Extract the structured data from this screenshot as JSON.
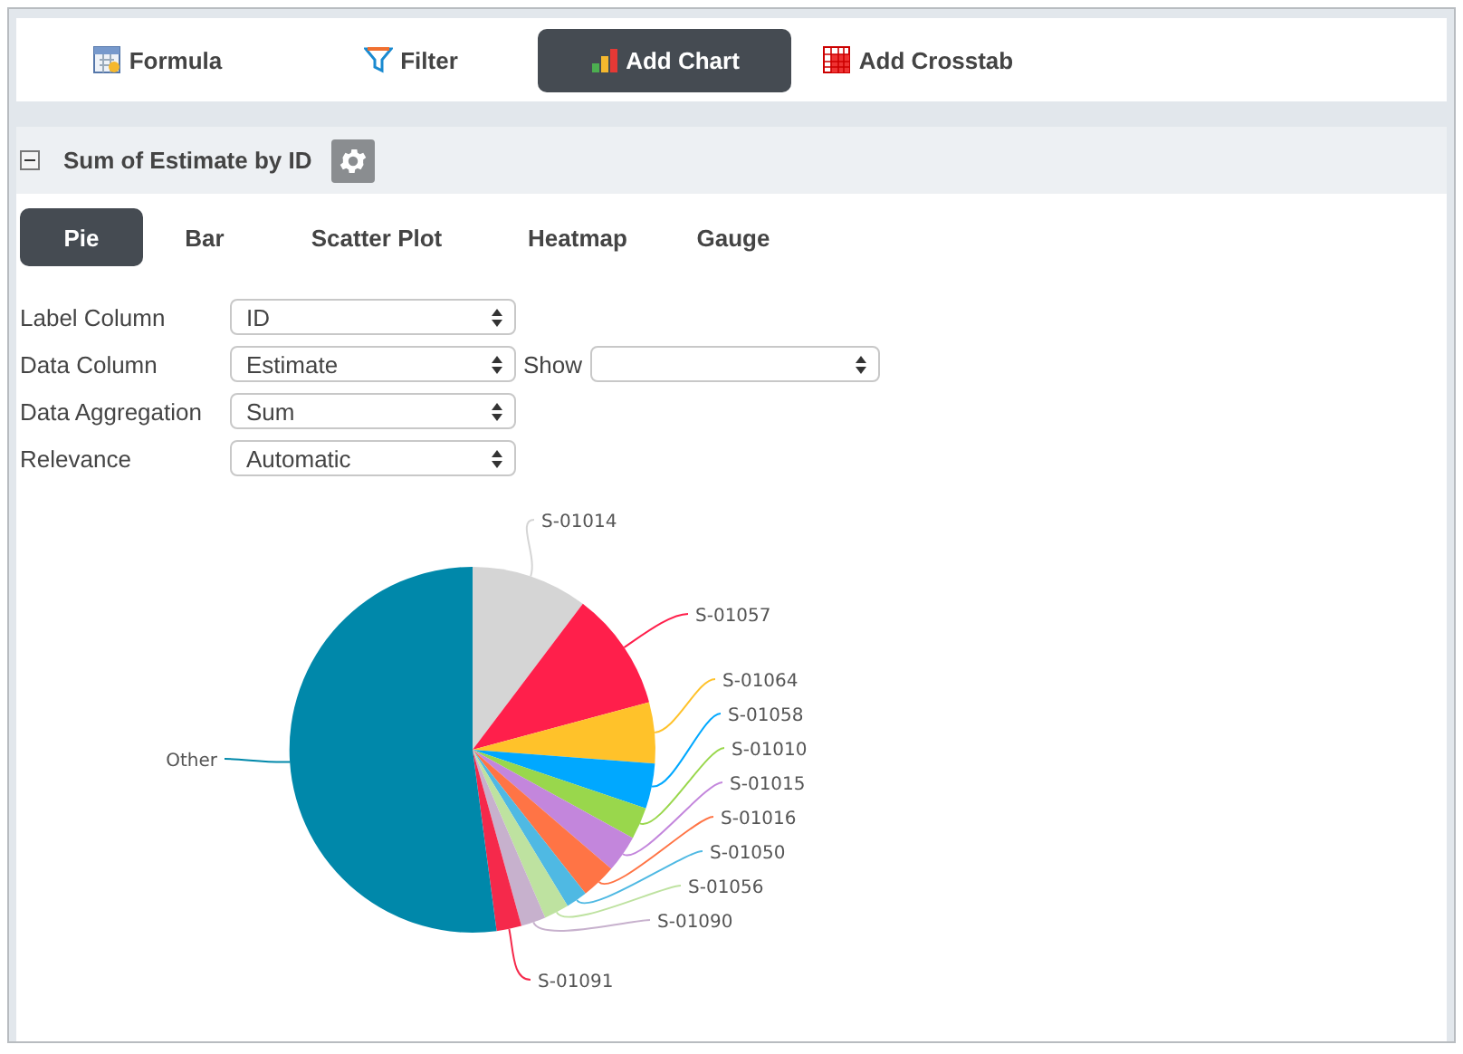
{
  "toolbar": [
    {
      "label": "Formula",
      "kind": "formula",
      "selected": false
    },
    {
      "label": "Filter",
      "kind": "filter",
      "selected": false
    },
    {
      "label": "Add Chart",
      "kind": "chart",
      "selected": true
    },
    {
      "label": "Add Crosstab",
      "kind": "crosstab",
      "selected": false
    }
  ],
  "panel": {
    "title": "Sum of Estimate by ID",
    "expanded": true
  },
  "chart_types": [
    {
      "label": "Pie",
      "selected": true
    },
    {
      "label": "Bar",
      "selected": false
    },
    {
      "label": "Scatter Plot",
      "selected": false
    },
    {
      "label": "Heatmap",
      "selected": false
    },
    {
      "label": "Gauge",
      "selected": false
    }
  ],
  "settings": [
    {
      "label": "Label Column",
      "value": "ID"
    },
    {
      "label": "Data Column",
      "value": "Estimate",
      "extra": {
        "label": "Show"
      }
    },
    {
      "label": "Data Aggregation",
      "value": "Sum"
    },
    {
      "label": "Relevance",
      "value": "Automatic"
    }
  ],
  "chart_data": {
    "type": "pie",
    "categories": [
      "S-01014",
      "S-01057",
      "S-01064",
      "S-01058",
      "S-01010",
      "S-01015",
      "S-01016",
      "S-01050",
      "S-01056",
      "S-01090",
      "S-01091",
      "Other"
    ],
    "values": [
      10.3,
      10.5,
      5.4,
      4.0,
      2.8,
      3.3,
      3.1,
      1.9,
      2.2,
      2.2,
      2.2,
      52.1
    ]
  }
}
